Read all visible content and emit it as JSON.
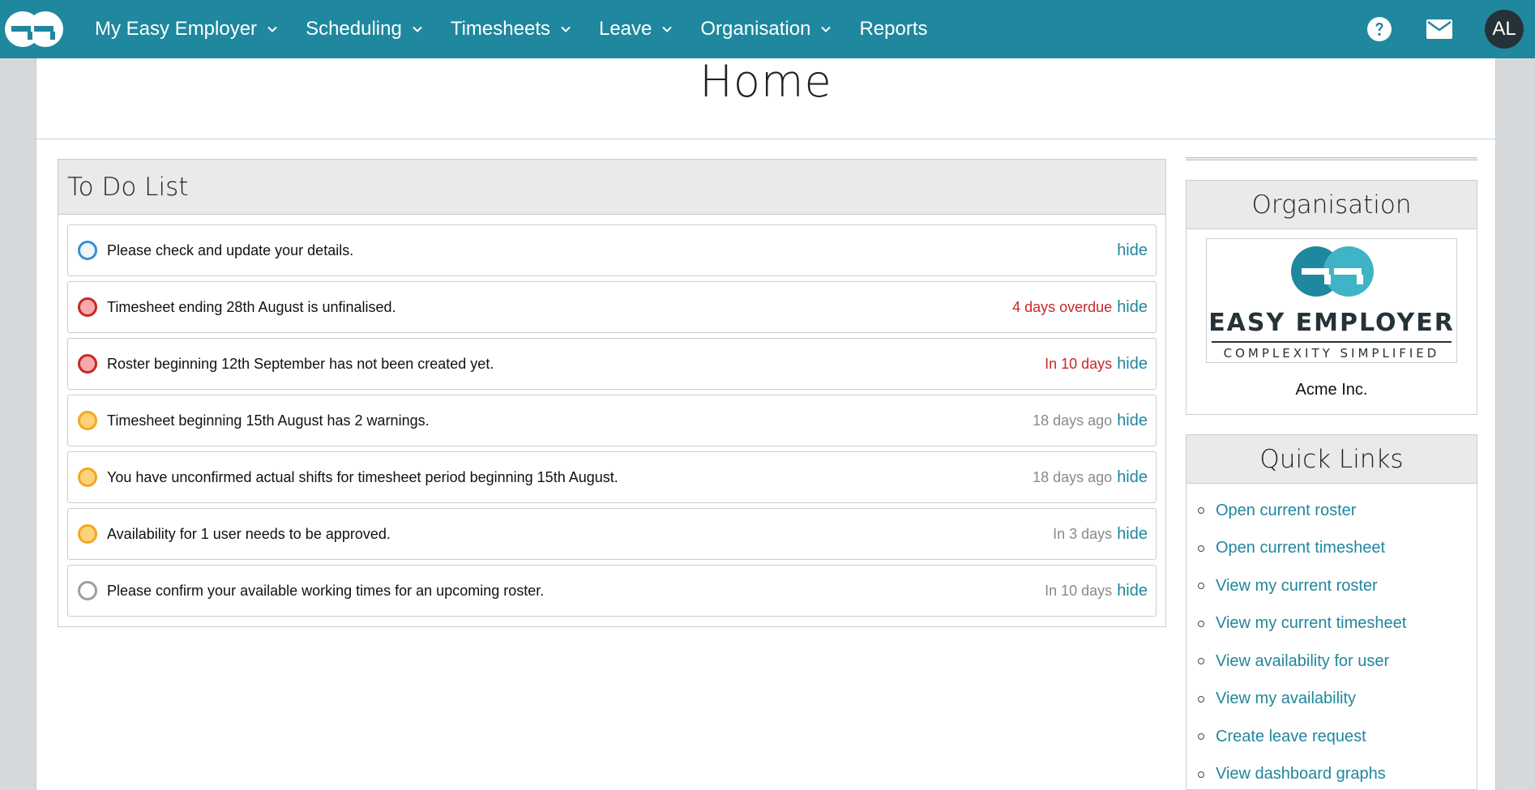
{
  "nav": {
    "items": [
      {
        "label": "My Easy Employer",
        "dropdown": true
      },
      {
        "label": "Scheduling",
        "dropdown": true
      },
      {
        "label": "Timesheets",
        "dropdown": true
      },
      {
        "label": "Leave",
        "dropdown": true
      },
      {
        "label": "Organisation",
        "dropdown": true
      },
      {
        "label": "Reports",
        "dropdown": false
      }
    ],
    "avatar_initials": "AL",
    "icons": [
      "help-icon",
      "mail-icon"
    ]
  },
  "page": {
    "title": "Home"
  },
  "todo": {
    "title": "To Do List",
    "items": [
      {
        "text": "Please check and update your details.",
        "due": "",
        "status": "blue",
        "hide": "hide"
      },
      {
        "text": "Timesheet ending 28th August is unfinalised.",
        "due": "4 days overdue",
        "status": "red",
        "hide": "hide"
      },
      {
        "text": "Roster beginning 12th September has not been created yet.",
        "due": "In 10 days",
        "status": "red",
        "hide": "hide"
      },
      {
        "text": "Timesheet beginning 15th August has 2 warnings.",
        "due": "18 days ago",
        "status": "orange",
        "hide": "hide"
      },
      {
        "text": "You have unconfirmed actual shifts for timesheet period beginning 15th August.",
        "due": "18 days ago",
        "status": "orange",
        "hide": "hide"
      },
      {
        "text": "Availability for 1 user needs to be approved.",
        "due": "In 3 days",
        "status": "orange",
        "hide": "hide"
      },
      {
        "text": "Please confirm your available working times for an upcoming roster.",
        "due": "In 10 days",
        "status": "grey",
        "hide": "hide"
      }
    ]
  },
  "organisation": {
    "title": "Organisation",
    "logo_text": "EASY EMPLOYER",
    "logo_tagline": "COMPLEXITY SIMPLIFIED",
    "name": "Acme Inc."
  },
  "quick_links": {
    "title": "Quick Links",
    "items": [
      "Open current roster",
      "Open current timesheet",
      "View my current roster",
      "View my current timesheet",
      "View availability for user",
      "View my availability",
      "Create leave request",
      "View dashboard graphs"
    ]
  },
  "colors": {
    "nav_bg": "#1f879e",
    "link": "#1f879e",
    "overdue": "#c62828",
    "muted": "#8a8a8a"
  }
}
